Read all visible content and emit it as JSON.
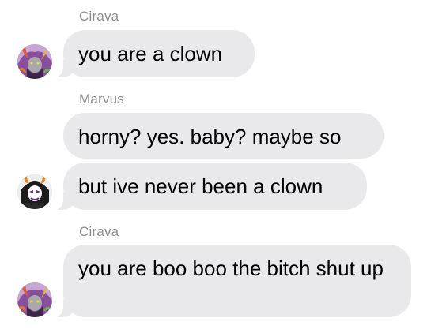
{
  "messages": [
    {
      "sender": "Cirava",
      "texts": [
        "you are a clown"
      ]
    },
    {
      "sender": "Marvus",
      "texts": [
        "horny? yes. baby? maybe so",
        "but ive never been a clown"
      ]
    },
    {
      "sender": "Cirava",
      "texts": [
        "you are boo boo the bitch shut up"
      ]
    }
  ],
  "avatars": {
    "cirava": "cirava-avatar",
    "marvus": "marvus-avatar"
  },
  "colors": {
    "bubble": "#e9e9eb",
    "sender_name": "#8e8e93",
    "text": "#000000",
    "background": "#ffffff"
  }
}
